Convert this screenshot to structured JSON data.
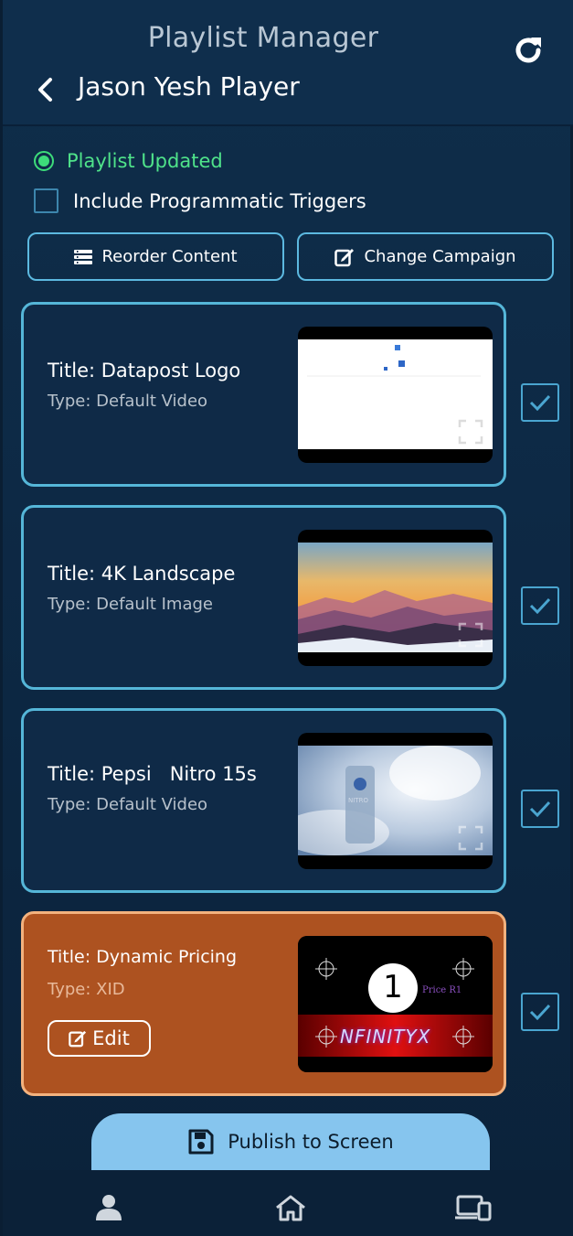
{
  "header": {
    "app_title": "Playlist Manager",
    "player_name": "Jason Yesh Player"
  },
  "status": {
    "text": "Playlist Updated",
    "color": "#4fe38a"
  },
  "options": {
    "programmatic_label": "Include Programmatic Triggers",
    "programmatic_checked": false
  },
  "actions": {
    "reorder_label": "Reorder Content",
    "campaign_label": "Change Campaign"
  },
  "items": [
    {
      "title": "Title: Datapost Logo",
      "type": "Type: Default Video",
      "selected": true,
      "thumb": "logo"
    },
    {
      "title": "Title: 4K Landscape",
      "type": "Type: Default Image",
      "selected": true,
      "thumb": "landscape"
    },
    {
      "title": "Title: Pepsi   Nitro 15s",
      "type": "Type: Default Video",
      "selected": true,
      "thumb": "pepsi"
    },
    {
      "title": "Title: Dynamic Pricing",
      "type": "Type: XID",
      "selected": true,
      "thumb": "xid",
      "edit_label": "Edit",
      "active": true
    }
  ],
  "thumb_text": {
    "xid_number": "1",
    "xid_price": "Price R1",
    "xid_brand": "NFINITYX",
    "pepsi_can": "NITRO"
  },
  "publish": {
    "label": "Publish to Screen"
  },
  "nav": {
    "items": [
      "user-icon",
      "home-icon",
      "devices-icon"
    ]
  },
  "colors": {
    "accent": "#55b6d8",
    "active_card": "#ad5220",
    "publish_bg": "#86c5ee"
  }
}
